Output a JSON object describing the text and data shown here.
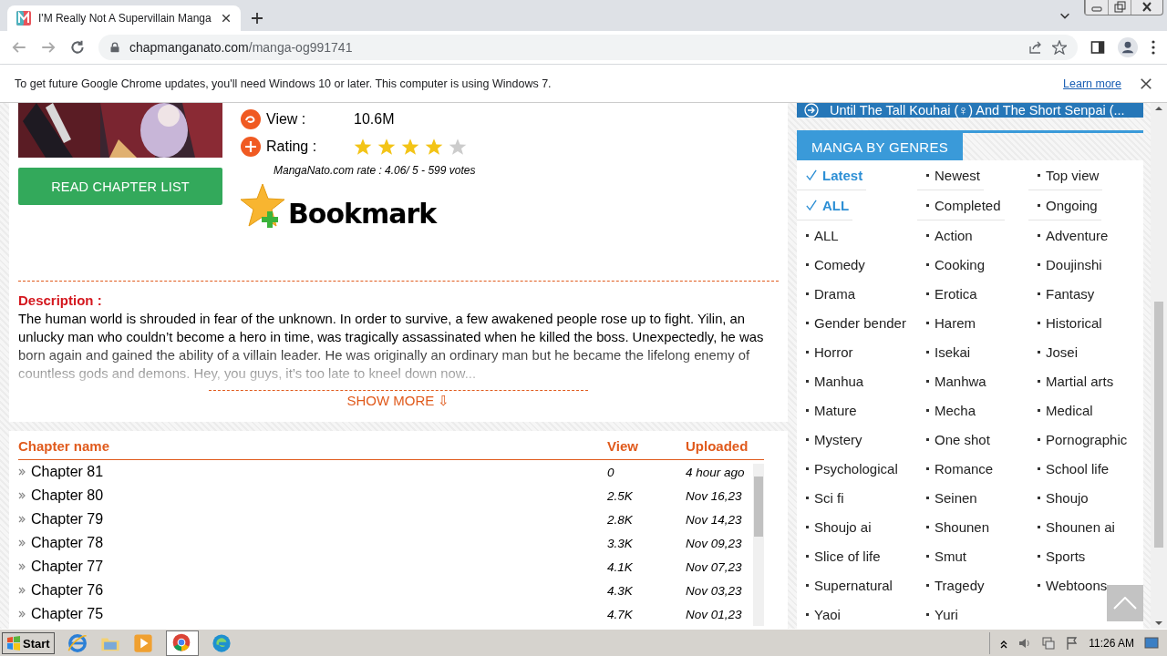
{
  "browser": {
    "tab_title": "I'M Really Not A Supervillain Manga",
    "url_domain": "chapmanganato.com",
    "url_path": "/manga-og991741"
  },
  "infobar": {
    "message": "To get future Google Chrome updates, you'll need Windows 10 or later. This computer is using Windows 7.",
    "link": "Learn more"
  },
  "manga": {
    "view_label": "View :",
    "view_value": "10.6M",
    "rating_label": "Rating :",
    "stars": 4,
    "rate_text": "MangaNato.com rate : 4.06/ 5 - 599 votes",
    "read_button": "READ CHAPTER LIST",
    "bookmark": "Bookmark"
  },
  "description": {
    "title": "Description :",
    "text": "The human world is shrouded in fear of the unknown. In order to survive, a few awakened people rose up to fight. Yilin, an unlucky man who couldn’t become a hero in time, was tragically assassinated when he killed the boss. Unexpectedly, he was born again and gained the ability of a villain leader. He was originally an ordinary man but he became the lifelong enemy of countless gods and demons. Hey, you guys, it’s too late to kneel down now...",
    "show_more": "SHOW MORE ⇩"
  },
  "chapters": {
    "columns": [
      "Chapter name",
      "View",
      "Uploaded"
    ],
    "rows": [
      {
        "name": "Chapter 81",
        "view": "0",
        "uploaded": "4 hour ago"
      },
      {
        "name": "Chapter 80",
        "view": "2.5K",
        "uploaded": "Nov 16,23"
      },
      {
        "name": "Chapter 79",
        "view": "2.8K",
        "uploaded": "Nov 14,23"
      },
      {
        "name": "Chapter 78",
        "view": "3.3K",
        "uploaded": "Nov 09,23"
      },
      {
        "name": "Chapter 77",
        "view": "4.1K",
        "uploaded": "Nov 07,23"
      },
      {
        "name": "Chapter 76",
        "view": "4.3K",
        "uploaded": "Nov 03,23"
      },
      {
        "name": "Chapter 75",
        "view": "4.7K",
        "uploaded": "Nov 01,23"
      }
    ]
  },
  "sidebar": {
    "banner": "Until The Tall Kouhai (♀) And The Short Senpai (...",
    "genres_title": "MANGA BY GENRES",
    "sort_rows": [
      [
        {
          "label": "Latest",
          "selected": true
        },
        {
          "label": "Newest",
          "selected": false
        },
        {
          "label": "Top view",
          "selected": false
        }
      ],
      [
        {
          "label": "ALL",
          "selected": true
        },
        {
          "label": "Completed",
          "selected": false
        },
        {
          "label": "Ongoing",
          "selected": false
        }
      ]
    ],
    "genres": [
      "ALL",
      "Action",
      "Adventure",
      "Comedy",
      "Cooking",
      "Doujinshi",
      "Drama",
      "Erotica",
      "Fantasy",
      "Gender bender",
      "Harem",
      "Historical",
      "Horror",
      "Isekai",
      "Josei",
      "Manhua",
      "Manhwa",
      "Martial arts",
      "Mature",
      "Mecha",
      "Medical",
      "Mystery",
      "One shot",
      "Pornographic",
      "Psychological",
      "Romance",
      "School life",
      "Sci fi",
      "Seinen",
      "Shoujo",
      "Shoujo ai",
      "Shounen",
      "Shounen ai",
      "Slice of life",
      "Smut",
      "Sports",
      "Supernatural",
      "Tragedy",
      "Webtoons",
      "Yaoi",
      "Yuri"
    ]
  },
  "taskbar": {
    "start": "Start",
    "time": "11:26 AM"
  }
}
